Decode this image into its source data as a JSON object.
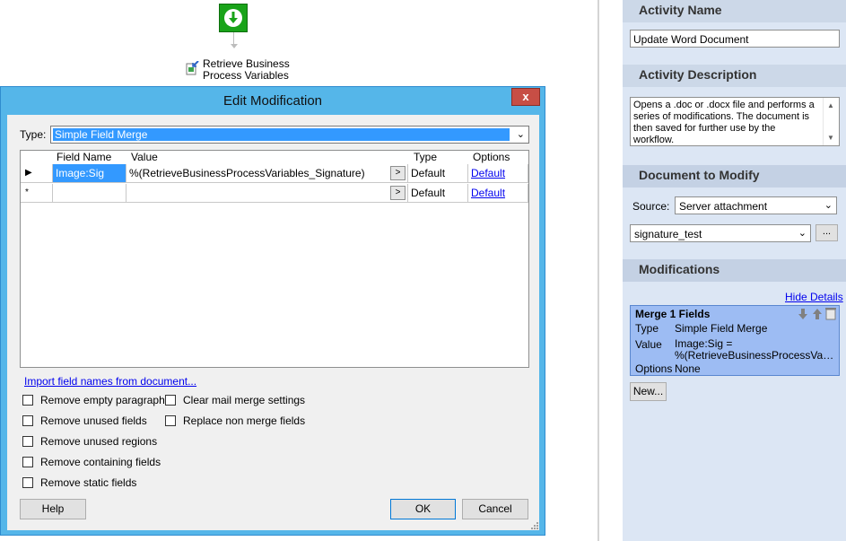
{
  "workflow": {
    "activity_label_line1": "Retrieve Business",
    "activity_label_line2": "Process Variables"
  },
  "panel": {
    "activity_name_header": "Activity Name",
    "activity_name_value": "Update Word Document",
    "activity_description_header": "Activity Description",
    "activity_description_value": "Opens a .doc or .docx file and performs a series of modifications. The document is then saved for further use by the workflow.",
    "document_header": "Document to Modify",
    "source_label": "Source:",
    "source_value": "Server attachment",
    "document_value": "signature_test",
    "browse_label": "...",
    "modifications_header": "Modifications",
    "hide_details": "Hide Details",
    "merge_card": {
      "title": "Merge  1  Fields",
      "type_key": "Type",
      "type_value": "Simple Field Merge",
      "value_key": "Value",
      "value_line1": "Image:Sig =",
      "value_line2": "%(RetrieveBusinessProcessVariabl...",
      "options_key": "Options",
      "options_value": "None"
    },
    "new_button": "New..."
  },
  "dialog": {
    "title": "Edit Modification",
    "close_label": "x",
    "type_label": "Type:",
    "type_value": "Simple Field Merge",
    "columns": {
      "field_name": "Field Name",
      "value": "Value",
      "type": "Type",
      "options": "Options"
    },
    "rows": [
      {
        "marker": "▶",
        "field_name": "Image:Sig",
        "value": "%(RetrieveBusinessProcessVariables_Signature)",
        "expand": ">",
        "type": "Default",
        "options": "Default"
      },
      {
        "marker": "*",
        "field_name": "",
        "value": "",
        "expand": ">",
        "type": "Default",
        "options": "Default"
      }
    ],
    "import_link": "Import field names from document...",
    "checkboxes": {
      "remove_empty_paragraphs": "Remove empty paragraphs",
      "remove_unused_fields": "Remove unused fields",
      "remove_unused_regions": "Remove unused regions",
      "remove_containing_fields": "Remove containing fields",
      "remove_static_fields": "Remove static fields",
      "clear_mail_merge": "Clear mail merge settings",
      "replace_non_merge": "Replace non merge fields"
    },
    "help_button": "Help",
    "ok_button": "OK",
    "cancel_button": "Cancel"
  },
  "colors": {
    "dialog_frame": "#55b6e9",
    "panel_bg": "#dce6f4",
    "selection": "#3399ff",
    "merge_card": "#9dbcf3",
    "start_node": "#19a319"
  }
}
